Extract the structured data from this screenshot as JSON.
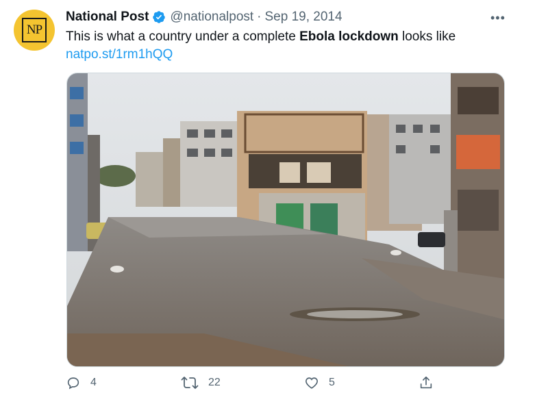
{
  "tweet": {
    "author_name": "National Post",
    "avatar_text": "NP",
    "handle": "@nationalpost",
    "separator": "·",
    "date": "Sep 19, 2014",
    "text_before": "This is what a country under a complete ",
    "text_bold": "Ebola lockdown",
    "text_after": " looks like",
    "link": "natpo.st/1rm1hQQ",
    "more_label": "•••"
  },
  "actions": {
    "reply_count": "4",
    "retweet_count": "22",
    "like_count": "5"
  },
  "colors": {
    "accent": "#1d9bf0",
    "avatar_bg": "#f4c430",
    "muted_text": "#536471"
  },
  "icons": [
    "verified-badge-icon",
    "more-options-icon",
    "reply-icon",
    "retweet-icon",
    "like-icon",
    "share-icon"
  ]
}
